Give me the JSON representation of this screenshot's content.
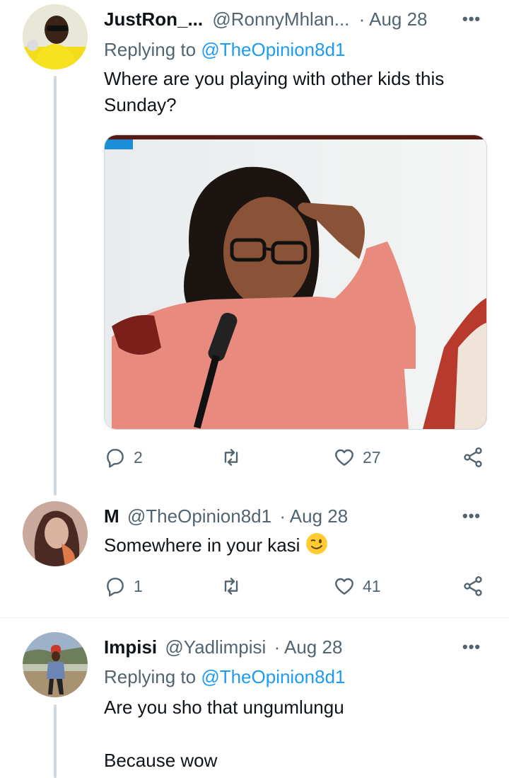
{
  "tweets": [
    {
      "name": "JustRon_...",
      "handle": "@RonnyMhlan...",
      "date": "· Aug 28",
      "replying_prefix": "Replying to",
      "replying_to": "@TheOpinion8d1",
      "text_line1": "Where are you playing with other kids this",
      "text_line2": "Sunday?",
      "replies": "2",
      "retweets": "",
      "likes": "27"
    },
    {
      "name": "M",
      "handle": "@TheOpinion8d1",
      "date": "· Aug 28",
      "text": "Somewhere in your kasi",
      "replies": "1",
      "retweets": "",
      "likes": "41"
    },
    {
      "name": "Impisi",
      "handle": "@Yadlimpisi",
      "date": "· Aug 28",
      "replying_prefix": "Replying to",
      "replying_to": "@TheOpinion8d1",
      "text_line1": "Are you sho that ungumlungu",
      "text_line2": "Because wow"
    }
  ],
  "icons": {
    "more": "more-icon",
    "reply": "reply-icon",
    "retweet": "retweet-icon",
    "like": "heart-icon",
    "share": "share-icon",
    "emoji": "winking-face-emoji"
  },
  "colors": {
    "link": "#1d9bf0",
    "muted": "#536471",
    "thread_line": "#cfd9de"
  }
}
